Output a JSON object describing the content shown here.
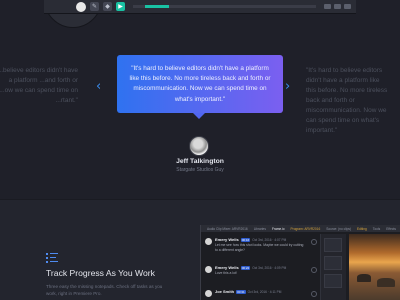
{
  "toolbar": {
    "icons": [
      "user-icon",
      "pencil-icon",
      "lock-icon",
      "play-icon"
    ]
  },
  "testimonial": {
    "quote": "\"It's hard to believe editors didn't have a platform like this before. No more tireless back and forth or miscommunication. Now we can spend time on what's important.\"",
    "side_quote_left": "...believe editors didn't have a platform ...and forth or ...ow we can spend time on ...rtant.\"",
    "side_quote_right": "\"It's hard to believe editors didn't have a platform like this before. No more tireless back and forth or miscommunication. Now we can spend time on what's important.\"",
    "author": "Jeff Talkington",
    "role": "Stargate Studios Guy",
    "prev_arrow": "‹",
    "next_arrow": "›",
    "accent": "#3a8ef2"
  },
  "feature": {
    "title": "Track Progress As You Work",
    "text": "Three easy the missing notepads. Check off tasks as you work, right in Premiere Pro."
  },
  "panel": {
    "tabs": [
      "Audio Clip Mixer: ARVR2016",
      "Libraries",
      "Frame.io",
      "Program: ARVR2016",
      "Source: (no clips)",
      "Editing",
      "Tools",
      "Effects"
    ],
    "comments": [
      {
        "name": "Emery Wells",
        "time": "00:16",
        "date": "Oct 3rd, 2016 · 4:07 PM",
        "text": "Let me see how this shot looks. Maybe we could try cutting to a different angle?"
      },
      {
        "name": "Emery Wells",
        "time": "00:22",
        "date": "Oct 3rd, 2016 · 4:09 PM",
        "text": "Love this a lot!"
      },
      {
        "name": "Joe Smith",
        "time": "00:31",
        "date": "Oct 3rd, 2016 · 4:11 PM",
        "text": ""
      }
    ]
  }
}
